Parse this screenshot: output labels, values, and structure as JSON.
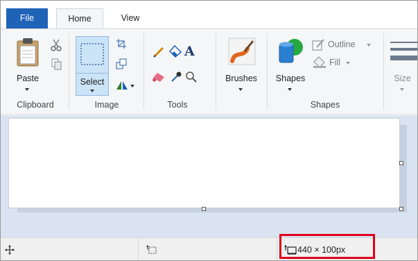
{
  "tabs": {
    "file": "File",
    "home": "Home",
    "view": "View"
  },
  "clipboard": {
    "paste_label": "Paste",
    "group_label": "Clipboard"
  },
  "image": {
    "select_label": "Select",
    "group_label": "Image"
  },
  "tools": {
    "group_label": "Tools",
    "text_glyph": "A"
  },
  "brushes": {
    "label": "Brushes"
  },
  "shapes": {
    "shapes_label": "Shapes",
    "outline_label": "Outline",
    "fill_label": "Fill",
    "group_label": "Shapes"
  },
  "size": {
    "label": "Size"
  },
  "statusbar": {
    "image_size": "440 × 100px"
  },
  "colors": {
    "accent": "#1f63b7",
    "selection": "#cce4f7",
    "highlight": "#e0001b",
    "canvas_bg": "#d9e3f1"
  }
}
